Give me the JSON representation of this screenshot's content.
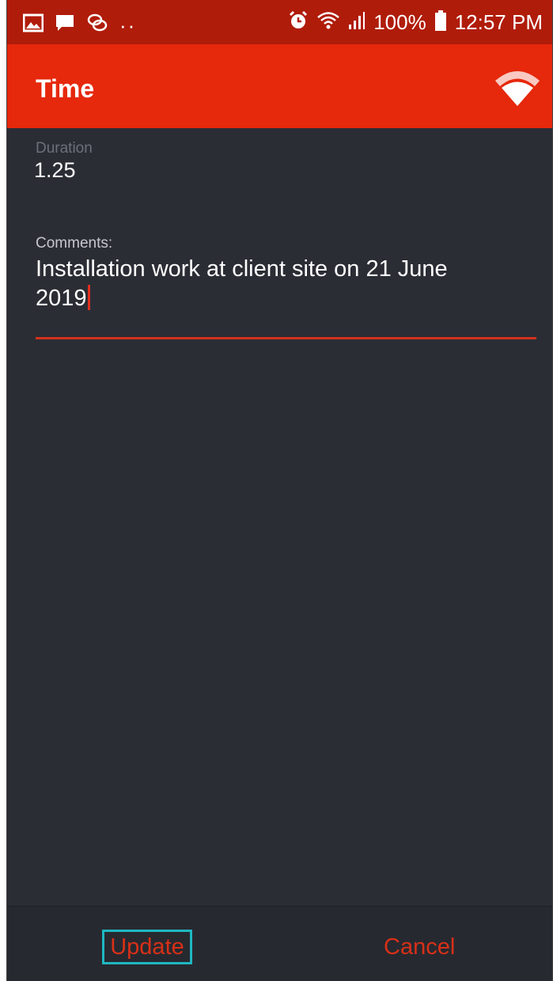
{
  "status_bar": {
    "battery": "100%",
    "time": "12:57 PM",
    "left_icons": [
      "gallery-icon",
      "message-icon",
      "chat-bubbles-icon",
      "more-dots-icon"
    ],
    "right_icons": [
      "alarm-icon",
      "wifi-signal-icon",
      "cell-signal-icon",
      "battery-icon"
    ]
  },
  "app_bar": {
    "title": "Time",
    "icon": "wifi-logo-icon",
    "color": "#e6280c"
  },
  "form": {
    "duration_label": "Duration",
    "duration_value": "1.25",
    "comments_label": "Comments:",
    "comments_line1": "Installation work at client site on 21 June",
    "comments_line2": "2019"
  },
  "actions": {
    "update_label": "Update",
    "cancel_label": "Cancel",
    "accent_color": "#d83017"
  }
}
